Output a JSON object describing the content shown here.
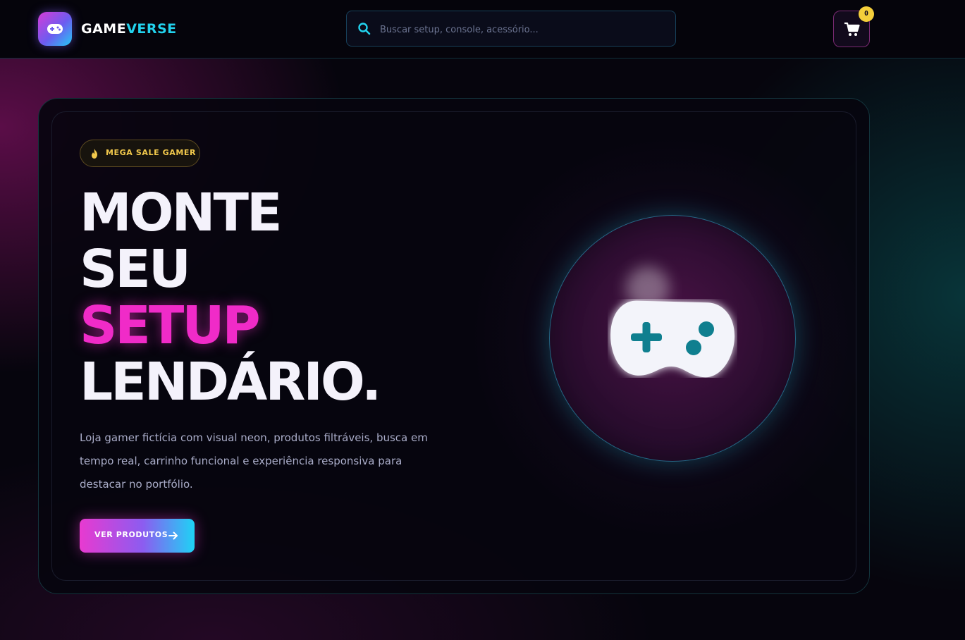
{
  "brand": {
    "part1": "GAME",
    "part2": "VERSE",
    "logo_icon": "gamepad-icon"
  },
  "search": {
    "placeholder": "Buscar setup, console, acessório...",
    "value": "",
    "icon": "search-icon"
  },
  "cart": {
    "icon": "cart-icon",
    "count": "0"
  },
  "hero": {
    "badge": {
      "icon": "fire-icon",
      "label": "MEGA SALE GAMER"
    },
    "headline": {
      "line1": "MONTE",
      "line2": "SEU",
      "line3": "SETUP",
      "line4": "LENDÁRIO."
    },
    "description": "Loja gamer fictícia com visual neon, produtos filtráveis, busca em tempo real, carrinho funcional e experiência responsiva para destacar no portfólio.",
    "cta": {
      "label": "VER PRODUTOS",
      "icon": "arrow-right-icon"
    },
    "art_icon": "gamepad-icon"
  },
  "colors": {
    "accent_pink": "#f02bc8",
    "accent_cyan": "#22d3ee",
    "badge_yellow": "#f5cf3b",
    "background": "#06050d"
  }
}
